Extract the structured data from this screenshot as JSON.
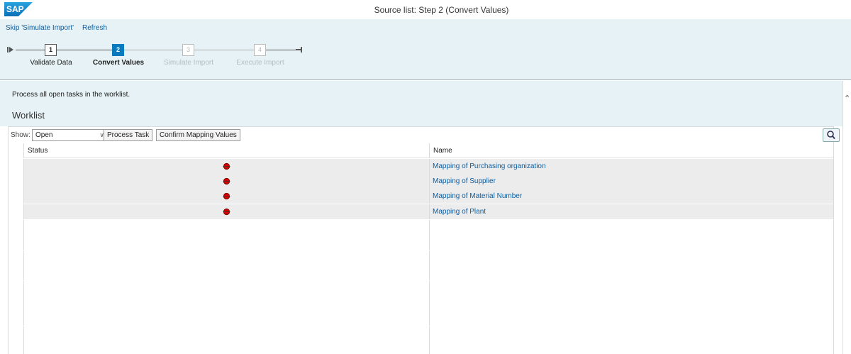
{
  "header": {
    "logo": "SAP",
    "title": "Source list: Step 2  (Convert Values)"
  },
  "toolbar": {
    "skip_label": "Skip 'Simulate Import'",
    "refresh_label": "Refresh"
  },
  "roadmap": {
    "steps": [
      {
        "number": "1",
        "label": "Validate Data",
        "state": "done"
      },
      {
        "number": "2",
        "label": "Convert Values",
        "state": "active"
      },
      {
        "number": "3",
        "label": "Simulate Import",
        "state": "disabled"
      },
      {
        "number": "4",
        "label": "Execute Import",
        "state": "disabled"
      }
    ]
  },
  "content": {
    "hint": "Process all open tasks in the worklist.",
    "worklist_title": "Worklist"
  },
  "table_toolbar": {
    "show_label": "Show:",
    "show_value": "Open",
    "process_task_label": "Process Task",
    "confirm_mapping_label": "Confirm Mapping Values",
    "search_icon": "magnifier-icon"
  },
  "table": {
    "columns": [
      "Status",
      "Name"
    ],
    "rows": [
      {
        "status": "red-light-icon",
        "name": "Mapping of Purchasing organization"
      },
      {
        "status": "red-light-icon",
        "name": "Mapping of Supplier"
      },
      {
        "status": "red-light-icon",
        "name": "Mapping of Material Number"
      },
      {
        "status": "red-light-icon",
        "name": "Mapping of Plant"
      }
    ]
  },
  "colors": {
    "accent": "#0a7abf",
    "link": "#0a5ea3",
    "panel_bg": "#e6f2f5",
    "status_error": "#d40000"
  }
}
